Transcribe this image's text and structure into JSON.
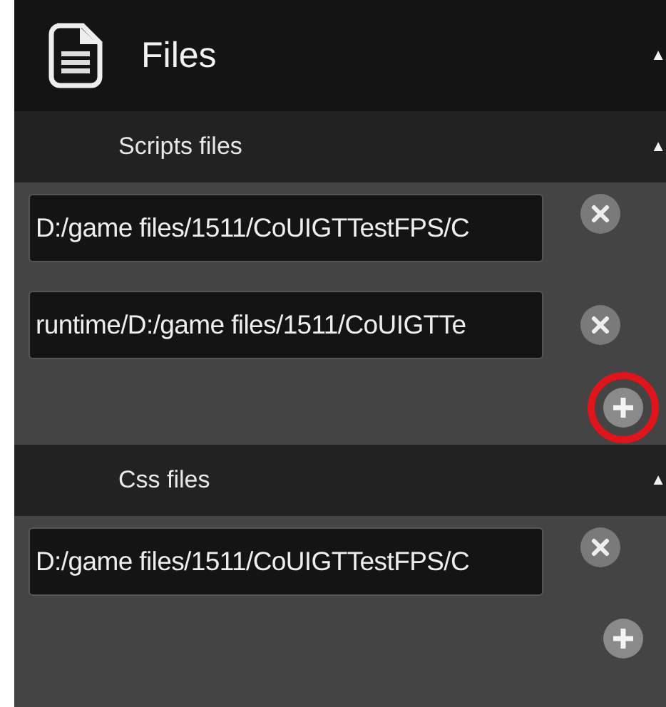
{
  "panel": {
    "title": "Files",
    "toggle": "▲"
  },
  "sections": [
    {
      "title": "Scripts files",
      "toggle": "▲",
      "files": [
        {
          "path": "D:/game files/1511/CoUIGTTestFPS/C"
        },
        {
          "path": "runtime/D:/game files/1511/CoUIGTTe"
        }
      ],
      "add_highlighted": true
    },
    {
      "title": "Css files",
      "toggle": "▲",
      "files": [
        {
          "path": "D:/game files/1511/CoUIGTTestFPS/C"
        }
      ],
      "add_highlighted": false
    }
  ]
}
